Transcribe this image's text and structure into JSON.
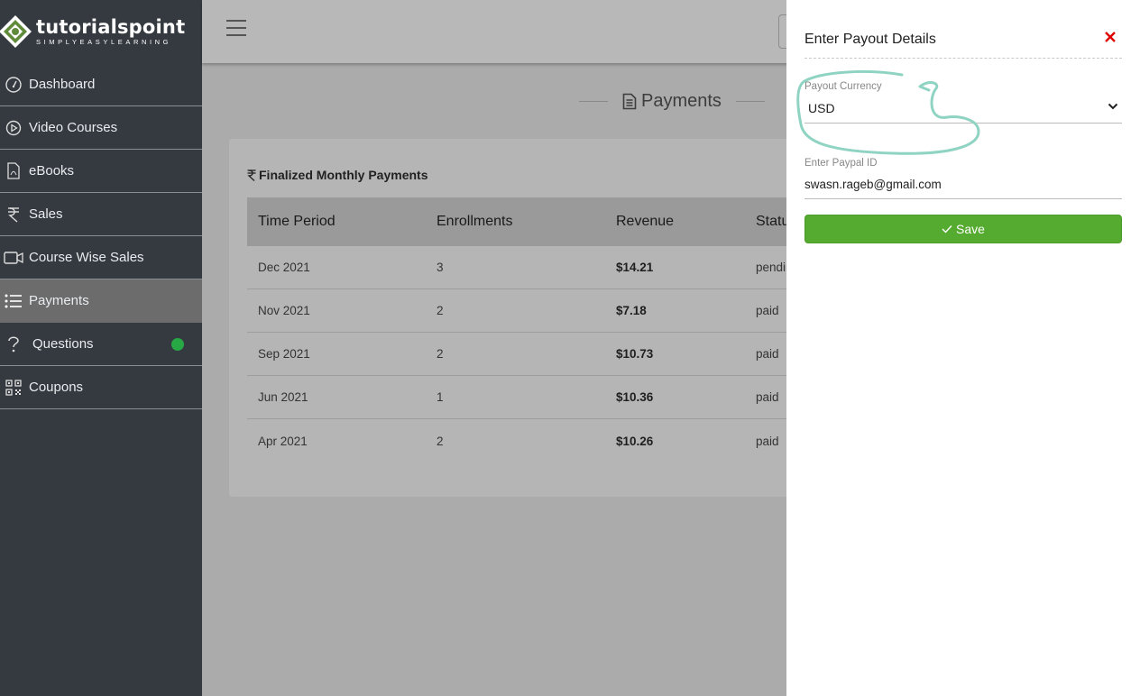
{
  "brand": {
    "name": "tutorialspoint",
    "tagline": "SIMPLYEASYLEARNING"
  },
  "sidebar": {
    "items": [
      {
        "label": "Dashboard",
        "icon": "dashboard-gauge-icon"
      },
      {
        "label": "Video Courses",
        "icon": "play-circle-icon"
      },
      {
        "label": "eBooks",
        "icon": "pdf-file-icon"
      },
      {
        "label": "Sales",
        "icon": "rupee-icon"
      },
      {
        "label": "Course Wise Sales",
        "icon": "video-camera-icon"
      },
      {
        "label": "Payments",
        "icon": "list-icon",
        "active": true
      },
      {
        "label": "Questions",
        "icon": "question-icon",
        "badge": "green-dot"
      },
      {
        "label": "Coupons",
        "icon": "qr-code-icon"
      }
    ]
  },
  "main": {
    "heading": "Payments",
    "card_title": "Finalized Monthly Payments",
    "table": {
      "headers": [
        "Time Period",
        "Enrollments",
        "Revenue",
        "Status"
      ],
      "rows": [
        {
          "period": "Dec 2021",
          "enrollments": "3",
          "revenue": "$14.21",
          "status": "pending"
        },
        {
          "period": "Nov 2021",
          "enrollments": "2",
          "revenue": "$7.18",
          "status": "paid"
        },
        {
          "period": "Sep 2021",
          "enrollments": "2",
          "revenue": "$10.73",
          "status": "paid"
        },
        {
          "period": "Jun 2021",
          "enrollments": "1",
          "revenue": "$10.36",
          "status": "paid"
        },
        {
          "period": "Apr 2021",
          "enrollments": "2",
          "revenue": "$10.26",
          "status": "paid"
        }
      ]
    }
  },
  "panel": {
    "title": "Enter Payout Details",
    "close_symbol": "✕",
    "currency_label": "Payout Currency",
    "currency_value": "USD",
    "paypal_label": "Enter Paypal ID",
    "paypal_value": "swasn.rageb@gmail.com",
    "save_label": "Save"
  },
  "colors": {
    "sidebar_bg": "#343a40",
    "active_item_bg": "#6c6c6c",
    "save_green": "#55ab2f",
    "close_red": "#e00000",
    "annotation_teal": "#8fd3c2"
  }
}
